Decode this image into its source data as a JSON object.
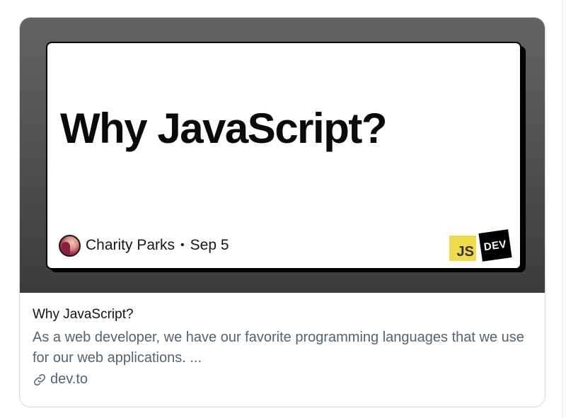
{
  "card": {
    "image": {
      "title": "Why JavaScript?",
      "author": "Charity Parks",
      "separator": "•",
      "date": "Sep 5",
      "logo_js": "JS",
      "logo_dev": "DEV"
    },
    "title": "Why JavaScript?",
    "description": "As a web developer, we have our favorite programming languages that we use for our web applications. ...",
    "domain": "dev.to",
    "icons": {
      "domain": "link-icon",
      "avatar": "avatar"
    }
  },
  "colors": {
    "text_primary": "#0f1419",
    "text_secondary": "#536471",
    "border": "#cfd9de",
    "js_yellow": "#f0db4f",
    "dev_black": "#000000"
  }
}
